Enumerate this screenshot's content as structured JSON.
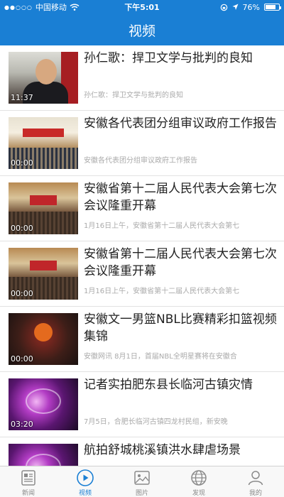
{
  "status_bar": {
    "carrier": "中国移动",
    "time": "下午5:01",
    "battery": "76%",
    "battery_level": 0.76
  },
  "header": {
    "title": "视频"
  },
  "videos": [
    {
      "title": "孙仁歌：捍卫文学与批判的良知",
      "desc": "孙仁歌：捍卫文学与批判的良知",
      "duration": "11:37",
      "thumb": "portrait"
    },
    {
      "title": "安徽各代表团分组审议政府工作报告",
      "desc": "安徽各代表团分组审议政府工作报告",
      "duration": "00:00",
      "thumb": "hall-meeting"
    },
    {
      "title": "安徽省第十二届人民代表大会第七次会议隆重开幕",
      "desc": "1月16日上午，安徽省第十二届人民代表大会第七",
      "duration": "00:00",
      "thumb": "hall-congress"
    },
    {
      "title": "安徽省第十二届人民代表大会第七次会议隆重开幕",
      "desc": "1月16日上午，安徽省第十二届人民代表大会第七",
      "duration": "00:00",
      "thumb": "hall-congress"
    },
    {
      "title": "安徽文一男篮NBL比赛精彩扣篮视频集锦",
      "desc": "安徽网讯 8月1日，首届NBL全明星赛将在安徽合",
      "duration": "00:00",
      "thumb": "basketball"
    },
    {
      "title": "记者实拍肥东县长临河古镇灾情",
      "desc": "7月5日，合肥长临河古镇四龙村民组，新安晚",
      "duration": "03:20",
      "thumb": "purple-news"
    },
    {
      "title": "航拍舒城桃溪镇洪水肆虐场景",
      "desc": "",
      "duration": "",
      "thumb": "purple-news"
    }
  ],
  "tabs": [
    {
      "label": "新闻",
      "icon": "newspaper-icon",
      "active": false
    },
    {
      "label": "视频",
      "icon": "play-circle-icon",
      "active": true
    },
    {
      "label": "图片",
      "icon": "picture-icon",
      "active": false
    },
    {
      "label": "发现",
      "icon": "globe-icon",
      "active": false
    },
    {
      "label": "我的",
      "icon": "user-icon",
      "active": false
    }
  ],
  "colors": {
    "brand": "#1a7fd4",
    "tab_inactive": "#8a8a8a"
  }
}
